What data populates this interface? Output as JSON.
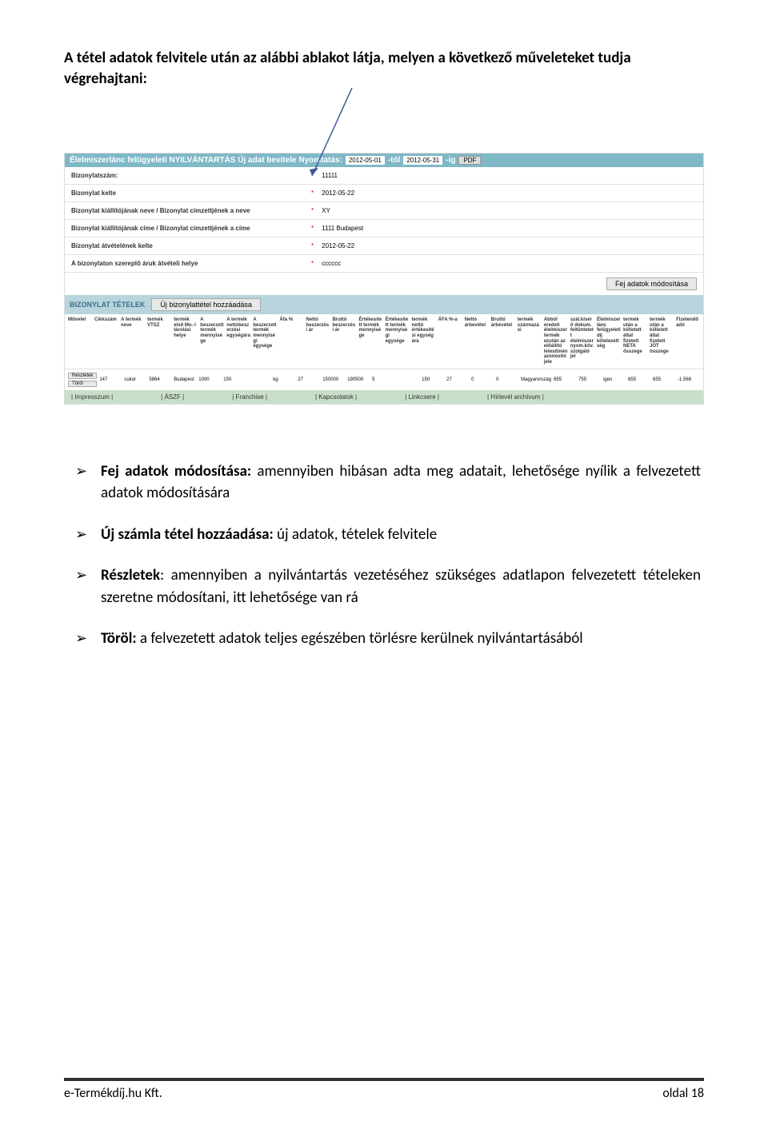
{
  "intro": "A tétel adatok felvitele után az alábbi ablakot látja, melyen a következő műveleteket tudja végrehajtani:",
  "screenshot": {
    "header_title": "Élelmiszerlánc felügyeleti NYILVÁNTARTÁS  Új adat bevitele Nyomtatás:",
    "date_from": "2012-05-01",
    "date_sep1": "-tól",
    "date_to": "2012-05-31",
    "date_sep2": "-ig",
    "pdf_label": "PDF",
    "rows": [
      {
        "label": "Bizonylatszám:",
        "value": "11111"
      },
      {
        "label": "Bizonylat kelte",
        "value": "2012-05-22"
      },
      {
        "label": "Bizonylat kiállítójának neve / Bizonylat címzettjének a neve",
        "value": "XY"
      },
      {
        "label": "Bizonylat kiállítójának címe / Bizonylat címzettjének a címe",
        "value": "1111 Budapest"
      },
      {
        "label": "Bizonylat átvételének kelte",
        "value": "2012-05-22"
      },
      {
        "label": "A bizonylaton szereplő áruk átvételi helye",
        "value": "cccccc"
      }
    ],
    "edit_btn": "Fej adatok módosítása",
    "tetelek_label": "BIZONYLAT TÉTELEK",
    "add_btn": "Új bizonylattétel hozzáadása",
    "columns": [
      "Művelet",
      "Cikkszám",
      "A termék neve",
      "termék VTSZ",
      "termék első Mo.-i tárolási helye",
      "A beszerzett termék mennyisége",
      "A termék nettóbeszerzési egységára",
      "A beszerzett termék mennyiségi egysége",
      "Áfa %",
      "Nettó beszerzési ár",
      "Bruttó beszerzési ár",
      "Értékesített termék mennyisége",
      "Értékesített termék mennyiségi egysége",
      "termék nettó értékesítési egység ára",
      "ÁFA %-a",
      "Nettó árbevétel",
      "Bruttó árbevétel",
      "termék származási",
      "Abból eredeti élelmiszer termék ezután az előállító letesítmén azonosító jele",
      "szál.kísérő dokum. feltüntetett élelmiszer nyom.köv. szolgáló jel",
      "Élelmiszerlánc felügyeleti díj kötelezettség",
      "termék után a kiilletett által fizetett NETA összege",
      "termék után a kiilletett által fizetett JÖT összege",
      "Fizetendő adó"
    ],
    "btn_reszletek": "Részletek",
    "btn_torol": "Töröl",
    "data": [
      "147",
      "cukor",
      "5864",
      "Budapest",
      "1000",
      "150",
      "",
      "kg",
      "27",
      "150000",
      "190500",
      "5",
      "",
      "150",
      "27",
      "0",
      "0",
      "Magyarország",
      "655",
      "755",
      "igen",
      "655",
      "655",
      "-1.568"
    ],
    "footerlinks": [
      "| Impresszum |",
      "| ÁSZF |",
      "| Franchise |",
      "| Kapcsolatok |",
      "| Linkcsere |",
      "| Hírlevél archívum |"
    ]
  },
  "bullets": {
    "b1_bold": "Fej adatok módosítása:",
    "b1_rest": " amennyiben hibásan adta meg adatait, lehetősége nyílik a felvezetett adatok módosítására",
    "b2_bold": "Új számla tétel hozzáadása:",
    "b2_rest": " új adatok, tételek felvitele",
    "b3_bold": "Részletek",
    "b3_rest": ": amennyiben a nyilvántartás vezetéséhez szükséges adatlapon felvezetett tételeken szeretne módosítani, itt lehetősége van rá",
    "b4_bold": "Töröl:",
    "b4_rest": " a felvezetett adatok teljes egészében törlésre kerülnek nyilvántartásából"
  },
  "footer": {
    "left": "e-Termékdíj.hu Kft.",
    "right": "oldal 18"
  }
}
